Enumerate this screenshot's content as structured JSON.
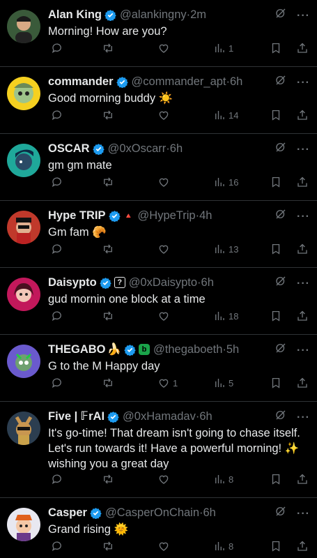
{
  "tweets": [
    {
      "name": "Alan King",
      "handle": "@alankingny",
      "time": "2m",
      "text": "Morning! How are you?",
      "likes": "",
      "views": "1",
      "avatar_color": "#3a5a3a",
      "extra_badge": "",
      "emoji": ""
    },
    {
      "name": "commander",
      "handle": "@commander_apt",
      "time": "6h",
      "text": "Good morning buddy",
      "likes": "",
      "views": "14",
      "avatar_color": "#f5d020",
      "extra_badge": "",
      "emoji": "☀️"
    },
    {
      "name": "OSCAR",
      "handle": "@0xOscarr",
      "time": "6h",
      "text": "gm gm mate",
      "likes": "",
      "views": "16",
      "avatar_color": "#1fa89a",
      "extra_badge": "",
      "emoji": ""
    },
    {
      "name": "Hype TRIP",
      "handle": "@HypeTrip",
      "time": "4h",
      "text": "Gm fam",
      "likes": "",
      "views": "13",
      "avatar_color": "#c0392b",
      "extra_badge": "🔺",
      "emoji": "🥐"
    },
    {
      "name": "Daisypto",
      "handle": "@0xDaisypto",
      "time": "6h",
      "text": "gud mornin one block at a time",
      "likes": "",
      "views": "18",
      "avatar_color": "#c2185b",
      "extra_badge": "?",
      "emoji": ""
    },
    {
      "name": "THEGABO",
      "handle": "@thegaboeth",
      "time": "5h",
      "text": "G to the M Happy day",
      "likes": "1",
      "views": "5",
      "avatar_color": "#6a5acd",
      "extra_badge": "b",
      "emoji": "",
      "name_emoji": "🍌"
    },
    {
      "name": "Five | 𝔽rAI",
      "handle": "@0xHamadav",
      "time": "6h",
      "text": "It's go-time! That dream isn't going to chase itself. Let's run towards it! Have a powerful morning! ✨  wishing you a great day",
      "likes": "",
      "views": "8",
      "avatar_color": "#2c3e50",
      "extra_badge": "",
      "emoji": ""
    },
    {
      "name": "Casper",
      "handle": "@CasperOnChain",
      "time": "6h",
      "text": "Grand rising",
      "likes": "",
      "views": "8",
      "avatar_color": "#e8e8f0",
      "extra_badge": "",
      "emoji": "🌞"
    }
  ],
  "icons": {
    "verified": "verified-badge-icon",
    "grok": "grok-icon",
    "more": "more-icon",
    "reply": "reply-icon",
    "retweet": "retweet-icon",
    "like": "like-icon",
    "views": "views-icon",
    "bookmark": "bookmark-icon",
    "share": "share-icon"
  },
  "colors": {
    "background": "#000000",
    "verified": "#1d9bf0",
    "muted": "#71767b",
    "divider": "#2f3336"
  }
}
